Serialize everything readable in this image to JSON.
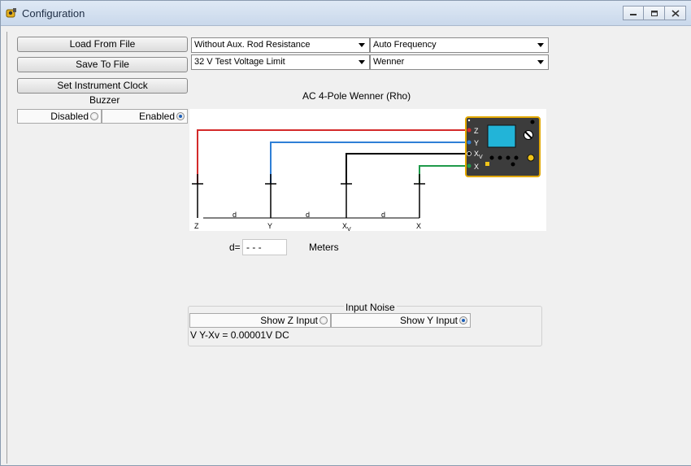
{
  "window": {
    "title": "Configuration",
    "icons": [
      "app-icon",
      "minimize-icon",
      "restore-icon",
      "close-icon"
    ]
  },
  "left_panel": {
    "load_button": "Load From File",
    "save_button": "Save To File",
    "clock_button": "Set Instrument Clock",
    "buzzer": {
      "label": "Buzzer",
      "options": [
        "Disabled",
        "Enabled"
      ],
      "selected": "Enabled"
    }
  },
  "dropdowns": {
    "aux_rod": "Without Aux. Rod Resistance",
    "frequency": "Auto Frequency",
    "voltage_limit": "32 V Test Voltage Limit",
    "method": "Wenner"
  },
  "diagram": {
    "title": "AC 4-Pole Wenner (Rho)",
    "probe_labels": [
      "Z",
      "Y",
      "X",
      "X"
    ],
    "probe_subscripts": [
      "",
      "",
      "V",
      ""
    ],
    "spacing_label": "d",
    "meter_terminals": [
      "Z",
      "Y",
      "X",
      "X"
    ],
    "meter_subscripts": [
      "",
      "",
      "V",
      ""
    ],
    "colors": {
      "z_wire": "#d42a2a",
      "y_wire": "#2f7fd6",
      "xv_wire": "#000000",
      "x_wire": "#1f9a4a",
      "meter_body": "#3c3c3c",
      "meter_border": "#e2a800",
      "screen": "#22b4d8"
    }
  },
  "spacing_field": {
    "label": "d=",
    "value": "- - -",
    "unit": "Meters"
  },
  "input_noise": {
    "label": "Input Noise",
    "show_z": "Show Z Input",
    "show_y": "Show Y Input",
    "selected": "Show Y Input",
    "reading": "V Y-Xv = 0.00001V DC"
  }
}
